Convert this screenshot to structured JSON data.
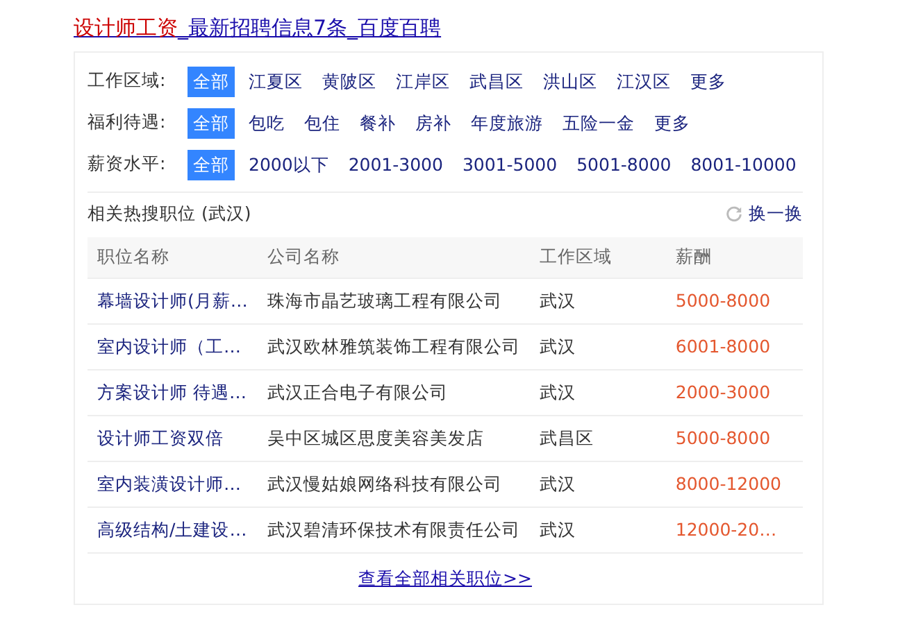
{
  "title": {
    "highlight": "设计师工资",
    "rest": "_最新招聘信息7条_百度百聘"
  },
  "filters": [
    {
      "label": "工作区域:",
      "options": [
        {
          "text": "全部",
          "selected": true
        },
        {
          "text": "江夏区",
          "selected": false
        },
        {
          "text": "黄陂区",
          "selected": false
        },
        {
          "text": "江岸区",
          "selected": false
        },
        {
          "text": "武昌区",
          "selected": false
        },
        {
          "text": "洪山区",
          "selected": false
        },
        {
          "text": "江汉区",
          "selected": false
        },
        {
          "text": "更多",
          "selected": false
        }
      ]
    },
    {
      "label": "福利待遇:",
      "options": [
        {
          "text": "全部",
          "selected": true
        },
        {
          "text": "包吃",
          "selected": false
        },
        {
          "text": "包住",
          "selected": false
        },
        {
          "text": "餐补",
          "selected": false
        },
        {
          "text": "房补",
          "selected": false
        },
        {
          "text": "年度旅游",
          "selected": false
        },
        {
          "text": "五险一金",
          "selected": false
        },
        {
          "text": "更多",
          "selected": false
        }
      ]
    },
    {
      "label": "薪资水平:",
      "options": [
        {
          "text": "全部",
          "selected": true
        },
        {
          "text": "2000以下",
          "selected": false
        },
        {
          "text": "2001-3000",
          "selected": false
        },
        {
          "text": "3001-5000",
          "selected": false
        },
        {
          "text": "5001-8000",
          "selected": false
        },
        {
          "text": "8001-10000",
          "selected": false
        }
      ]
    }
  ],
  "related": {
    "heading": "相关热搜职位 (武汉)",
    "refresh": "换一换"
  },
  "table": {
    "columns": [
      "职位名称",
      "公司名称",
      "工作区域",
      "薪酬"
    ],
    "rows": [
      [
        "幕墙设计师(月薪…",
        "珠海市晶艺玻璃工程有限公司",
        "武汉",
        "5000-8000"
      ],
      [
        "室内设计师（工…",
        "武汉欧林雅筑装饰工程有限公司",
        "武汉",
        "6001-8000"
      ],
      [
        "方案设计师 待遇…",
        "武汉正合电子有限公司",
        "武汉",
        "2000-3000"
      ],
      [
        "设计师工资双倍",
        "吴中区城区思度美容美发店",
        "武昌区",
        "5000-8000"
      ],
      [
        "室内装潢设计师…",
        "武汉慢姑娘网络科技有限公司",
        "武汉",
        "8000-12000"
      ],
      [
        "高级结构/土建设…",
        "武汉碧清环保技术有限责任公司",
        "武汉",
        "12000-20…"
      ]
    ]
  },
  "more_link": "查看全部相关职位>>"
}
